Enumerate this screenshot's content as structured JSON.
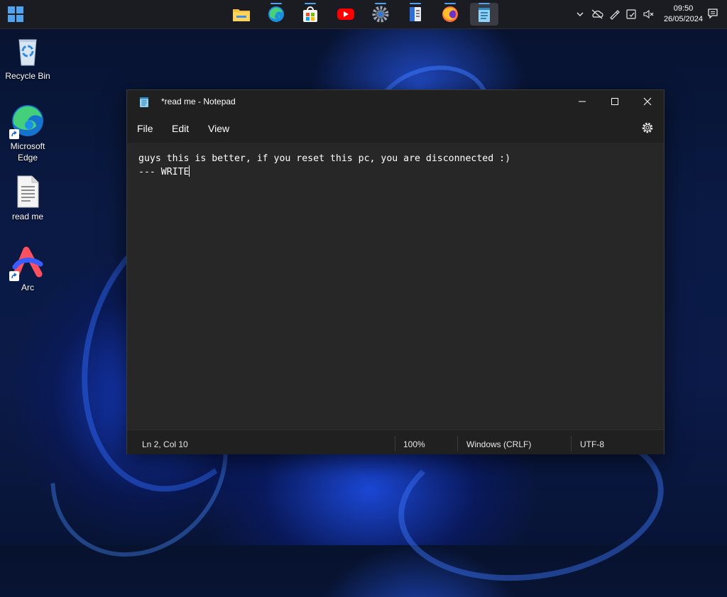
{
  "taskbar": {
    "apps": [
      {
        "name": "File Explorer",
        "icon": "folder-icon"
      },
      {
        "name": "Microsoft Edge",
        "icon": "edge-icon"
      },
      {
        "name": "Microsoft Store",
        "icon": "store-icon"
      },
      {
        "name": "YouTube",
        "icon": "youtube-icon"
      },
      {
        "name": "Settings",
        "icon": "settings-icon"
      },
      {
        "name": "Notebook app",
        "icon": "notebook-icon"
      },
      {
        "name": "Firefox",
        "icon": "firefox-icon"
      },
      {
        "name": "Notepad",
        "icon": "notepad-icon"
      }
    ],
    "tray": {
      "time": "09:50",
      "date": "26/05/2024"
    }
  },
  "desktop": {
    "icons": [
      {
        "label": "Recycle Bin",
        "icon": "recycle-bin-icon"
      },
      {
        "label": "Microsoft Edge",
        "icon": "edge-icon"
      },
      {
        "label": "read me",
        "icon": "text-file-icon"
      },
      {
        "label": "Arc",
        "icon": "arc-icon"
      }
    ]
  },
  "notepad": {
    "title": "*read me - Notepad",
    "menu": {
      "file": "File",
      "edit": "Edit",
      "view": "View"
    },
    "content_line1": "guys this is better, if you reset this pc, you are disconnected :)",
    "content_line2": "--- WRITE",
    "status": {
      "position": "Ln 2, Col 10",
      "zoom": "100%",
      "line_ending": "Windows (CRLF)",
      "encoding": "UTF-8"
    }
  },
  "colors": {
    "accent": "#4fa3f0",
    "editor_bg": "#272727",
    "chrome_bg": "#202020"
  }
}
